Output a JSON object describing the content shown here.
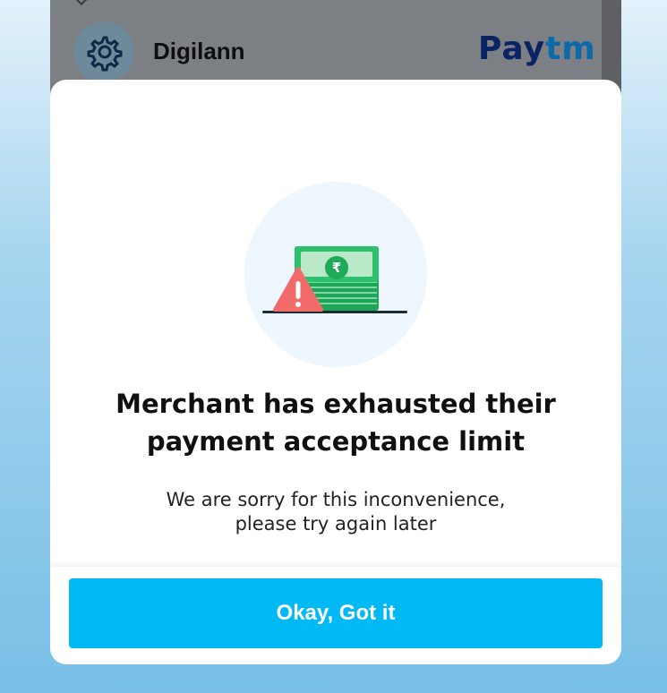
{
  "merchant": {
    "name": "Digilann",
    "avatar_icon": "gear-icon"
  },
  "brand": {
    "logo_part1": "Pay",
    "logo_part2": "tm",
    "colors": {
      "pay": "#0a2463",
      "tm": "#0b6aa7"
    }
  },
  "dialog": {
    "illustration": "cash-bundle-warning-icon",
    "title_line1": "Merchant has exhausted their",
    "title_line2": "payment acceptance limit",
    "message_line1": "We are sorry for this inconvenience,",
    "message_line2": "please try again later",
    "button_label": "Okay, Got it",
    "accent_color": "#00b9f5"
  }
}
